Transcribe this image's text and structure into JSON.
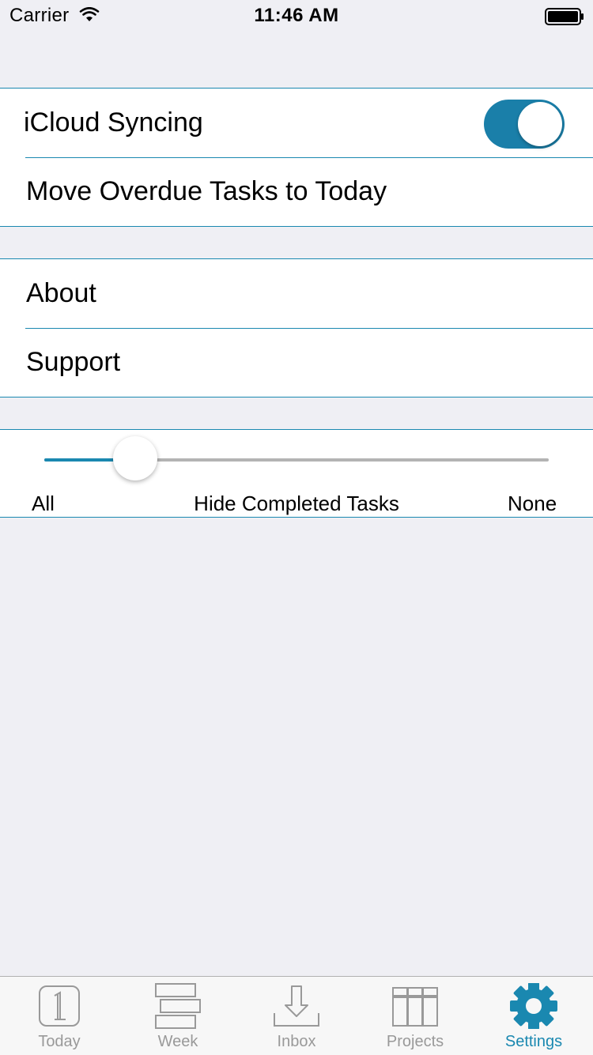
{
  "status_bar": {
    "carrier": "Carrier",
    "time": "11:46 AM",
    "wifi_icon": "wifi-icon",
    "battery_icon": "battery-icon"
  },
  "settings": {
    "icloud_label": "iCloud Syncing",
    "icloud_enabled": true,
    "move_overdue_label": "Move Overdue Tasks to Today",
    "about_label": "About",
    "support_label": "Support"
  },
  "slider": {
    "min_label": "All",
    "title": "Hide Completed Tasks",
    "max_label": "None",
    "value": 0.18
  },
  "tabs": [
    {
      "label": "Today",
      "icon": "calendar-day-icon",
      "active": false
    },
    {
      "label": "Week",
      "icon": "week-bars-icon",
      "active": false
    },
    {
      "label": "Inbox",
      "icon": "inbox-tray-icon",
      "active": false
    },
    {
      "label": "Projects",
      "icon": "projects-columns-icon",
      "active": false
    },
    {
      "label": "Settings",
      "icon": "gear-icon",
      "active": true
    }
  ],
  "colors": {
    "accent": "#1a88b0",
    "background": "#efeff4",
    "inactive_tab": "#999999"
  }
}
